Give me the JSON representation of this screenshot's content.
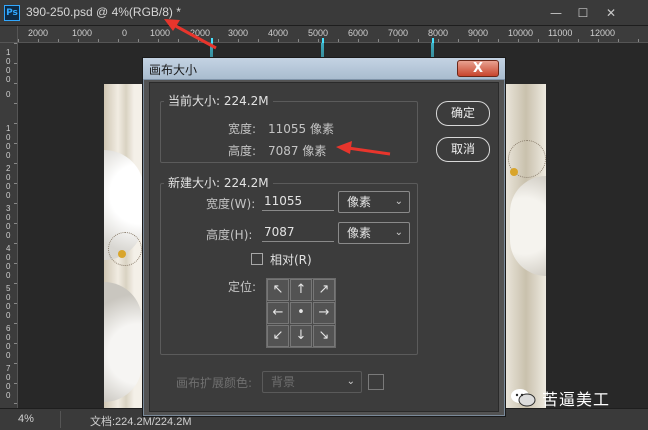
{
  "window": {
    "app_icon": "Ps",
    "title": "390-250.psd @ 4%(RGB/8) *",
    "min_glyph": "—",
    "max_glyph": "☐",
    "close_glyph": "✕"
  },
  "ruler": {
    "top_labels": [
      "2000",
      "1000",
      "0",
      "1000",
      "2000",
      "3000",
      "4000",
      "5000",
      "6000",
      "7000",
      "8000",
      "9000",
      "10000",
      "11000",
      "12000"
    ],
    "left_labels": [
      "1000",
      "0",
      "1000",
      "2000",
      "3000",
      "4000",
      "5000",
      "6000",
      "7000"
    ]
  },
  "dialog": {
    "title": "画布大小",
    "close_glyph": "X",
    "current_size": {
      "legend": "当前大小: 224.2M",
      "width_label": "宽度:",
      "width_value": "11055 像素",
      "height_label": "高度:",
      "height_value": "7087 像素"
    },
    "new_size": {
      "legend": "新建大小: 224.2M",
      "width_label": "宽度(W):",
      "width_value": "11055",
      "width_unit": "像素",
      "height_label": "高度(H):",
      "height_value": "7087",
      "height_unit": "像素",
      "relative_label": "相对(R)",
      "relative_checked": false,
      "anchor_label": "定位:",
      "anchor_glyphs": [
        "↖",
        "↑",
        "↗",
        "←",
        "•",
        "→",
        "↙",
        "↓",
        "↘"
      ]
    },
    "extension_color_label": "画布扩展颜色:",
    "extension_color_value": "背景",
    "ok_label": "确定",
    "cancel_label": "取消"
  },
  "status": {
    "zoom": "4%",
    "doc_info": "文档:224.2M/224.2M"
  },
  "watermark": {
    "text": "苦逼美工"
  },
  "colors": {
    "annotation_arrow": "#e8352c",
    "guide": "#45e3ff",
    "dialog_title_gradient": "#b5c6d8",
    "close_button": "#c8452d"
  }
}
